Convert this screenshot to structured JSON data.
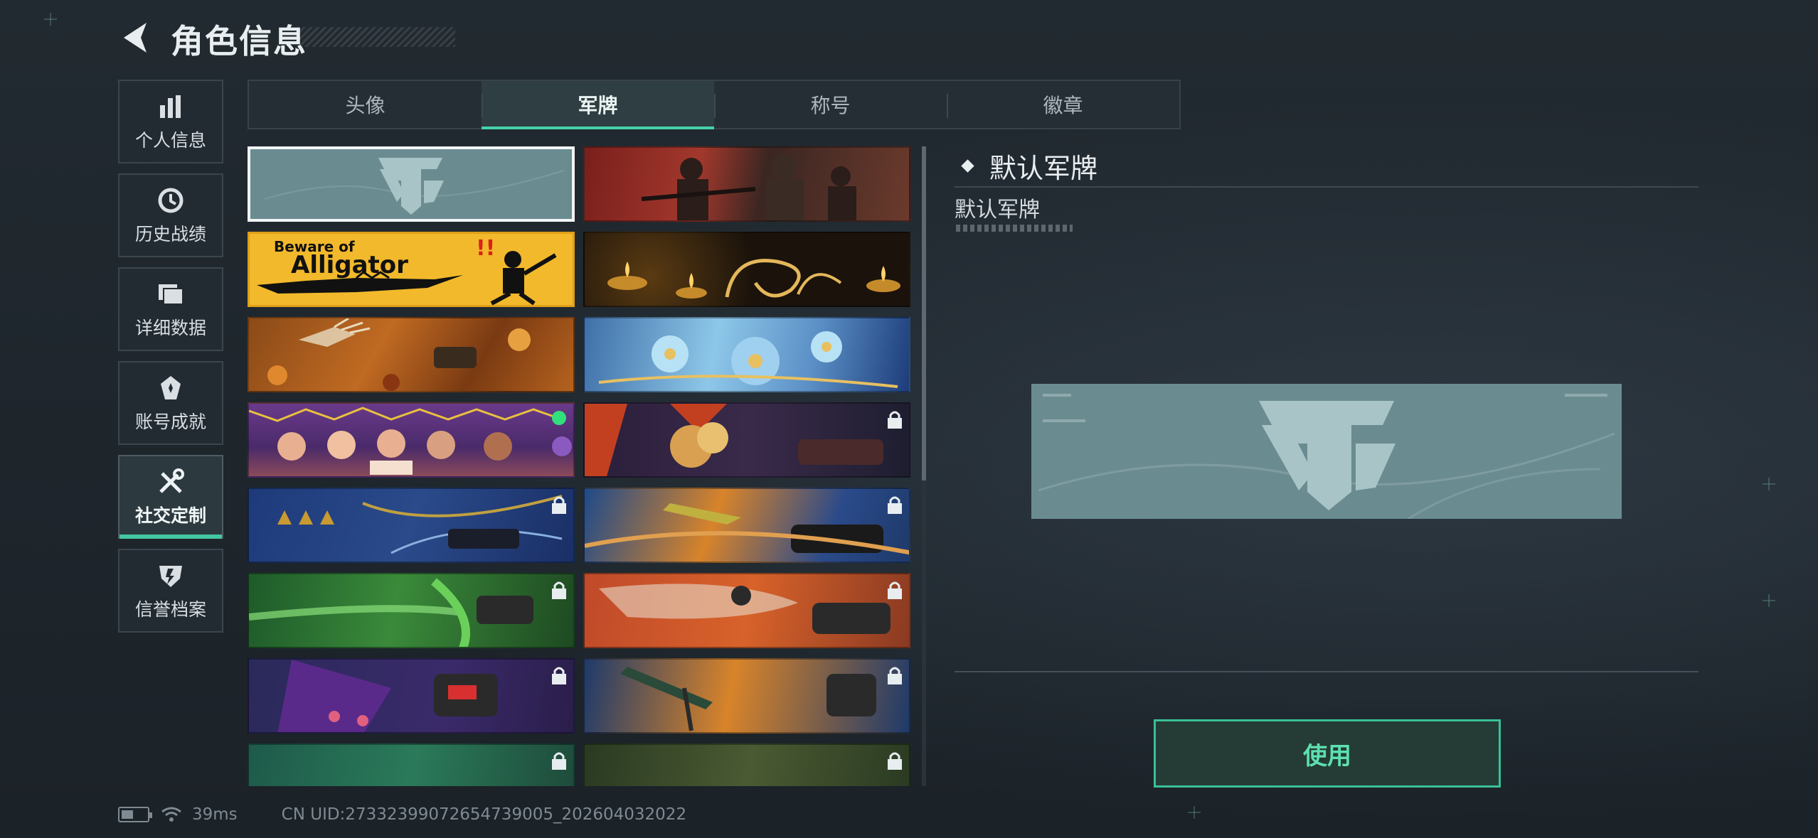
{
  "header": {
    "title": "角色信息"
  },
  "nav": [
    {
      "id": "personal",
      "label": "个人信息",
      "icon": "bar-chart-icon"
    },
    {
      "id": "history",
      "label": "历史战绩",
      "icon": "clock-history-icon"
    },
    {
      "id": "details",
      "label": "详细数据",
      "icon": "folder-icon"
    },
    {
      "id": "achievements",
      "label": "账号成就",
      "icon": "medal-icon"
    },
    {
      "id": "social",
      "label": "社交定制",
      "icon": "tools-icon",
      "active": true
    },
    {
      "id": "credit",
      "label": "信誉档案",
      "icon": "shield-icon"
    }
  ],
  "tabs": [
    {
      "label": "头像"
    },
    {
      "label": "军牌",
      "active": true
    },
    {
      "label": "称号"
    },
    {
      "label": "徽章"
    }
  ],
  "cards": [
    {
      "theme": "default",
      "selected": true,
      "locked": false
    },
    {
      "theme": "soldiers",
      "locked": false
    },
    {
      "theme": "alligator",
      "locked": false,
      "text": "Beware of",
      "text2": "Alligator"
    },
    {
      "theme": "candles",
      "locked": false
    },
    {
      "theme": "autumn",
      "locked": false
    },
    {
      "theme": "flowers",
      "locked": false
    },
    {
      "theme": "party",
      "locked": false
    },
    {
      "theme": "explosion",
      "locked": true
    },
    {
      "theme": "blue-wind",
      "locked": true
    },
    {
      "theme": "orange-blue",
      "locked": true
    },
    {
      "theme": "green-swirl",
      "locked": true
    },
    {
      "theme": "orange-sketch",
      "locked": true
    },
    {
      "theme": "purple-paw",
      "locked": true
    },
    {
      "theme": "orange-rocket",
      "locked": true
    },
    {
      "theme": "teal-dark",
      "locked": true
    },
    {
      "theme": "forest-dark",
      "locked": true
    }
  ],
  "detail": {
    "title": "默认军牌",
    "name": "默认军牌",
    "use_label": "使用"
  },
  "status": {
    "ping": "39ms",
    "uid": "CN UID:27332399072654739005_202604032022"
  },
  "colors": {
    "accent": "#45d2a9",
    "card_default": "#6a8c91"
  }
}
